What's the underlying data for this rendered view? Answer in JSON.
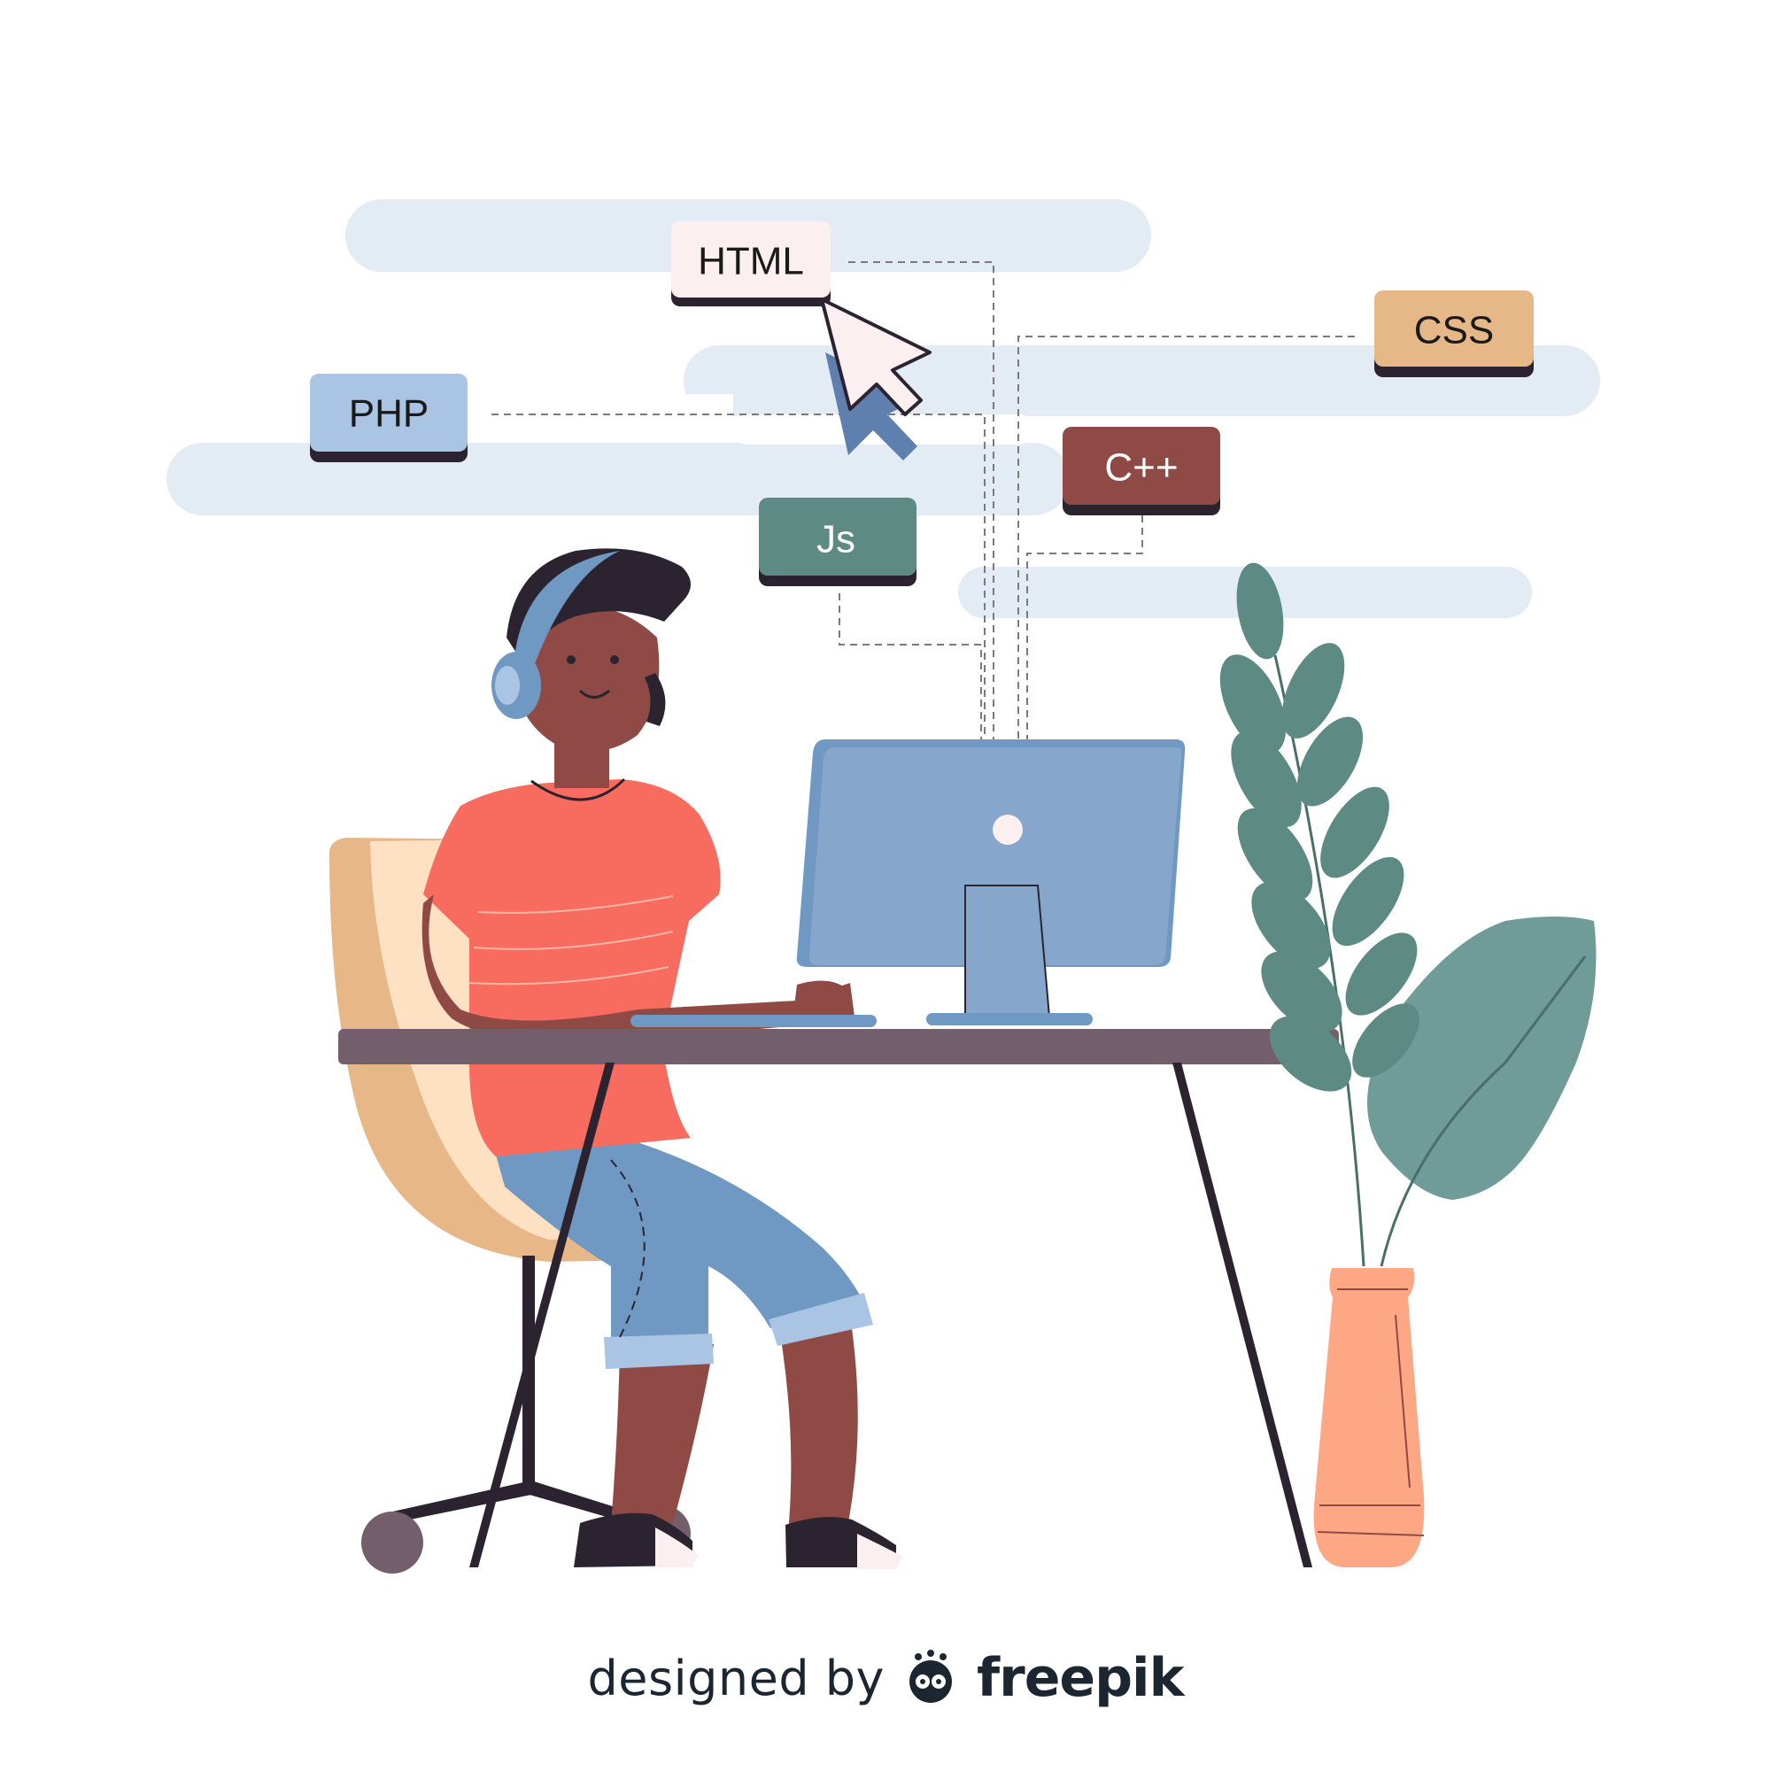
{
  "illustration": {
    "tags": {
      "html": "HTML",
      "css": "CSS",
      "php": "PHP",
      "cpp": "C++",
      "js": "Js"
    },
    "icons": [
      "mouse-cursor-icon",
      "headphones-icon",
      "freepik-logo-icon"
    ],
    "colors": {
      "cloud": "#e3ebf5",
      "html_tag": "#fbeff0",
      "css_tag": "#e6b887",
      "php_tag": "#a9c5e3",
      "cpp_tag": "#8f4a45",
      "js_tag": "#5e8a84",
      "shirt": "#f76c5e",
      "jeans": "#6f99c2",
      "skin": "#8f4a45",
      "monitor": "#87a6cb",
      "desk": "#735e6b",
      "chair": "#e8b787",
      "plant": "#5e8a84",
      "vase": "#fda785"
    }
  },
  "credit": {
    "designed_by": "designed by",
    "brand": "freepik"
  }
}
